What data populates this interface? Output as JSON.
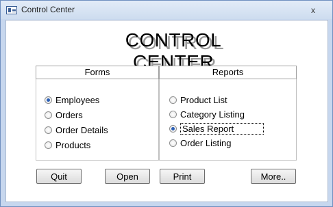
{
  "window": {
    "title": "Control Center",
    "close_symbol": "x"
  },
  "main": {
    "heading": "CONTROL CENTER"
  },
  "forms": {
    "header": "Forms",
    "items": [
      {
        "label": "Employees",
        "selected": true
      },
      {
        "label": "Orders",
        "selected": false
      },
      {
        "label": "Order Details",
        "selected": false
      },
      {
        "label": "Products",
        "selected": false
      }
    ]
  },
  "reports": {
    "header": "Reports",
    "items": [
      {
        "label": "Product List",
        "selected": false
      },
      {
        "label": "Category Listing",
        "selected": false
      },
      {
        "label": "Sales Report",
        "selected": true
      },
      {
        "label": "Order Listing",
        "selected": false
      }
    ]
  },
  "buttons": {
    "quit": "Quit",
    "open": "Open",
    "print": "Print",
    "more": "More.."
  }
}
